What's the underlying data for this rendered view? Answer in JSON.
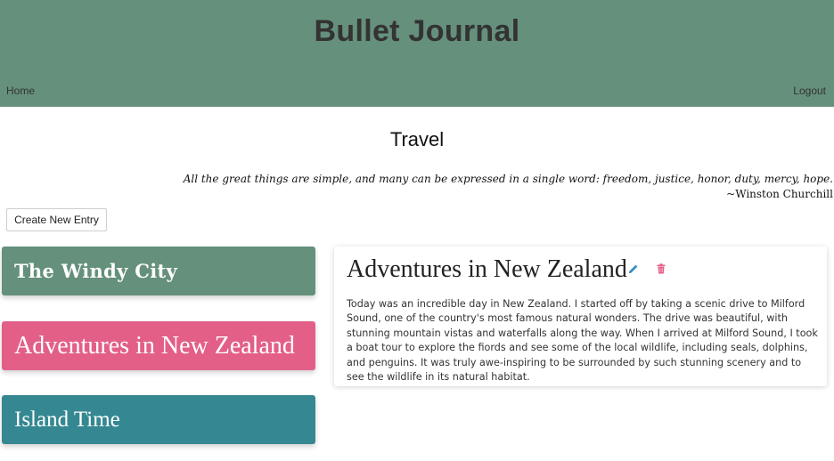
{
  "header": {
    "title": "Bullet Journal",
    "nav": {
      "home": "Home",
      "logout": "Logout"
    }
  },
  "category": {
    "title": "Travel",
    "quote": "All the great things are simple, and many can be expressed in a single word: freedom, justice, honor, duty, mercy, hope.",
    "quote_author": "~Winston Churchill"
  },
  "actions": {
    "create_label": "Create New Entry"
  },
  "entries": [
    {
      "title": "The Windy City",
      "color": "#65907c"
    },
    {
      "title": "Adventures in New Zealand",
      "color": "#e35f88"
    },
    {
      "title": "Island Time",
      "color": "#358891"
    }
  ],
  "selected_entry": {
    "title": "Adventures in New Zealand",
    "body": "Today was an incredible day in New Zealand. I started off by taking a scenic drive to Milford Sound, one of the country's most famous natural wonders. The drive was beautiful, with stunning mountain vistas and waterfalls along the way. When I arrived at Milford Sound, I took a boat tour to explore the fiords and see some of the local wildlife, including seals, dolphins, and penguins. It was truly awe-inspiring to be surrounded by such stunning scenery and to see the wildlife in its natural habitat.",
    "icons": {
      "edit": "pencil-icon",
      "delete": "trash-icon"
    }
  },
  "colors": {
    "header_bg": "#65907c",
    "accent_pink": "#e35f88",
    "accent_teal": "#358891",
    "edit_icon": "#3a8fc4",
    "delete_icon": "#e35f88"
  }
}
